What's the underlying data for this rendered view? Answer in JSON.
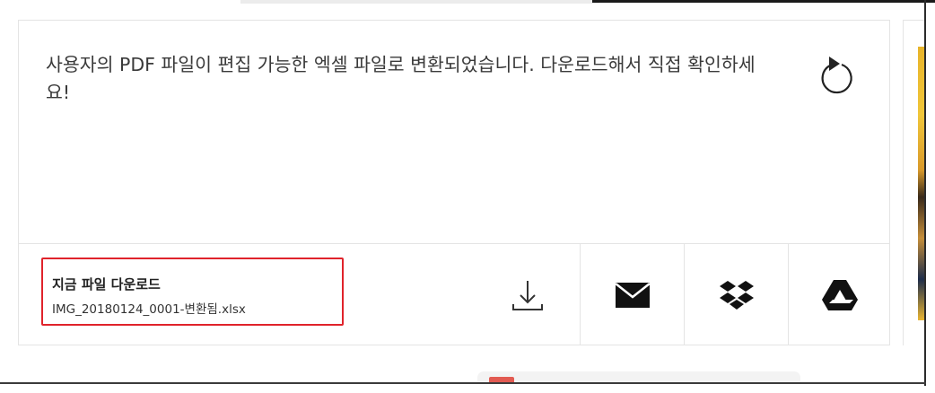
{
  "result": {
    "message": "사용자의 PDF 파일이 편집 가능한 엑셀 파일로 변환되었습니다. 다운로드해서 직접 확인하세요!",
    "refresh_icon": "refresh-icon"
  },
  "download": {
    "title": "지금 파일 다운로드",
    "filename": "IMG_20180124_0001-변환됨.xlsx",
    "highlight_color": "#e0232b"
  },
  "actions": [
    {
      "name": "download",
      "icon": "download-icon"
    },
    {
      "name": "email",
      "icon": "envelope-icon"
    },
    {
      "name": "dropbox",
      "icon": "dropbox-icon"
    },
    {
      "name": "google-drive",
      "icon": "google-drive-icon"
    }
  ]
}
